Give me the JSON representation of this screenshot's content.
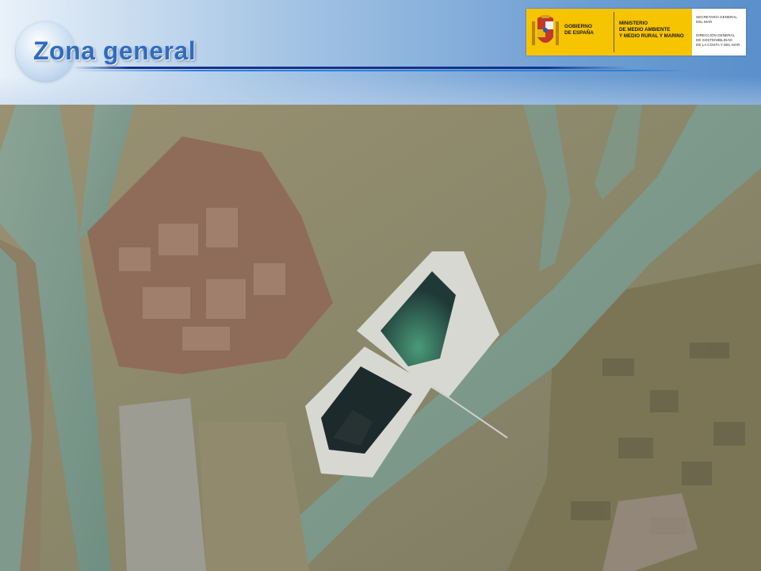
{
  "slide": {
    "title": "Zona general"
  },
  "logo": {
    "gov_line1": "GOBIERNO",
    "gov_line2": "DE ESPAÑA",
    "ministry_line1": "MINISTERIO",
    "ministry_line2": "DE MEDIO AMBIENTE",
    "ministry_line3": "Y MEDIO RURAL Y MARINO",
    "secretaria_line1": "SECRETARÍA GENERAL",
    "secretaria_line2": "DEL MAR",
    "direccion_line1": "DIRECCIÓN GENERAL",
    "direccion_line2": "DE SOSTENIBILIDAD",
    "direccion_line3": "DE LA COSTA Y DEL MAR"
  },
  "colors": {
    "title": "#2f6cc0",
    "logo_yellow": "#f6c400",
    "river": "#7c9a8c",
    "marsh": "#8e8a6e",
    "pond_dark": "#1c2a2c",
    "pond_green": "#2a6b58",
    "salt_flat": "#d8d8d2",
    "urban": "#8f6c5a"
  }
}
